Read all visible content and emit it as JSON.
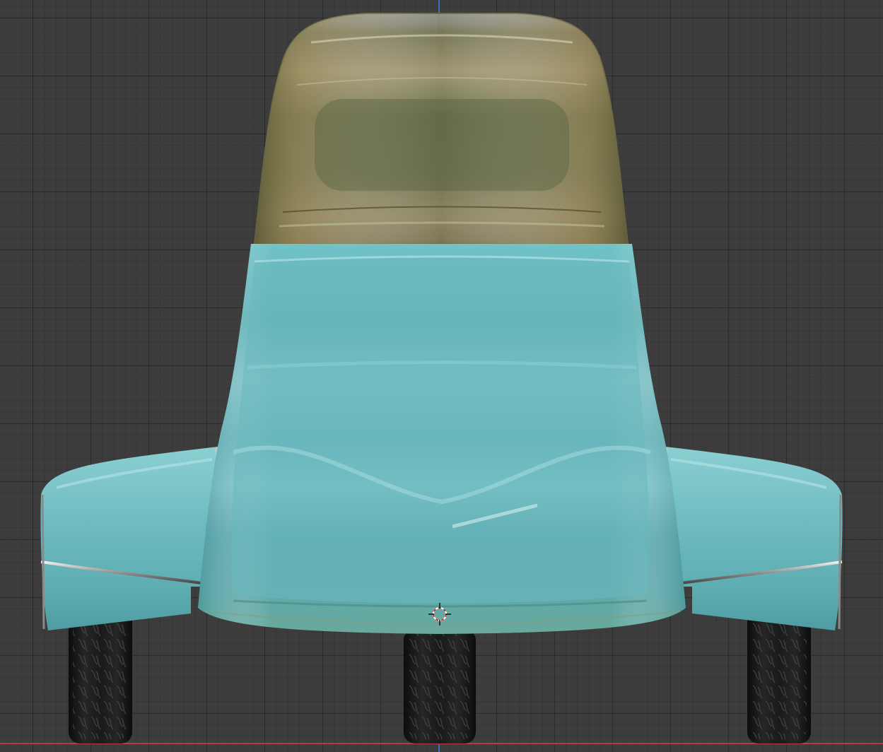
{
  "viewport": {
    "view": "front-orthographic",
    "background_color": "#3d3d3d",
    "grid": true
  },
  "axes": {
    "x_axis_color": "#b33a4c",
    "z_axis_color": "#3d6fb8"
  },
  "model": {
    "object": "car",
    "body_color": "#6fbcc0",
    "glass_tint": "#8a8a55",
    "tire_color": "#1a1a1a",
    "trim_color": "#c9c9c9"
  },
  "icons": {
    "cursor": "3d-cursor-icon"
  }
}
